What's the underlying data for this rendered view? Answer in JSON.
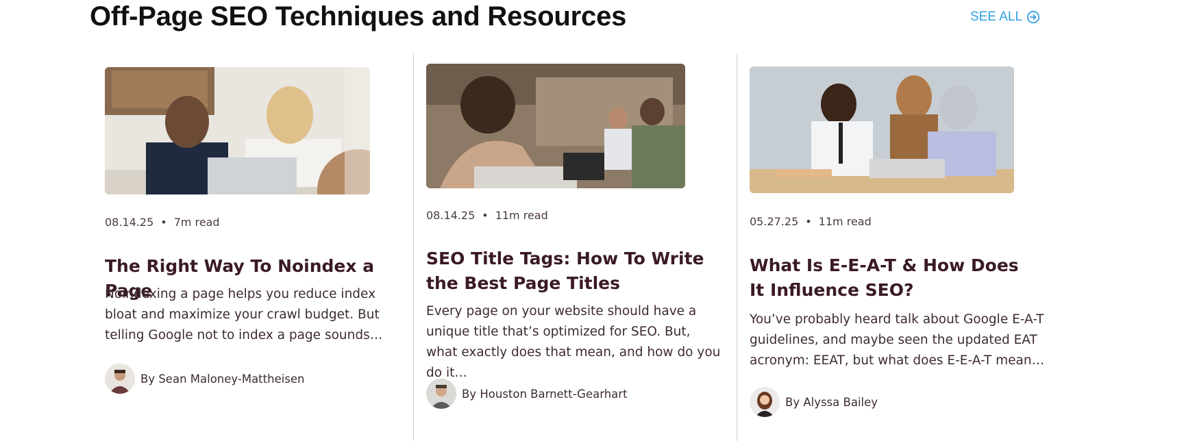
{
  "section": {
    "title": "Off-Page SEO Techniques and Resources",
    "see_all_label": "SEE ALL",
    "accent_color": "#2f9fe0"
  },
  "cards": [
    {
      "date": "08.14.25",
      "separator": "•",
      "read_time": "7m read",
      "title": "The Right Way To Noindex a Page",
      "excerpt": "Noindexing a page helps you reduce index bloat and maximize your crawl budget. But telling Google not to index a page sounds…",
      "author": "By Sean Maloney-Mattheisen"
    },
    {
      "date": "08.14.25",
      "separator": "•",
      "read_time": "11m read",
      "title": "SEO Title Tags: How To Write the Best Page Titles",
      "excerpt": "Every page on your website should have a unique title that’s optimized for SEO. But, what exactly does that mean, and how do you do it…",
      "author": "By Houston Barnett-Gearhart"
    },
    {
      "date": "05.27.25",
      "separator": "•",
      "read_time": "11m read",
      "title": "What Is E-E-A-T & How Does It Influence SEO?",
      "excerpt": "You’ve probably heard talk about Google E-A-T guidelines, and maybe seen the updated EAT acronym: EEAT, but what does E-E-A-T mean…",
      "author": "By Alyssa Bailey"
    }
  ]
}
